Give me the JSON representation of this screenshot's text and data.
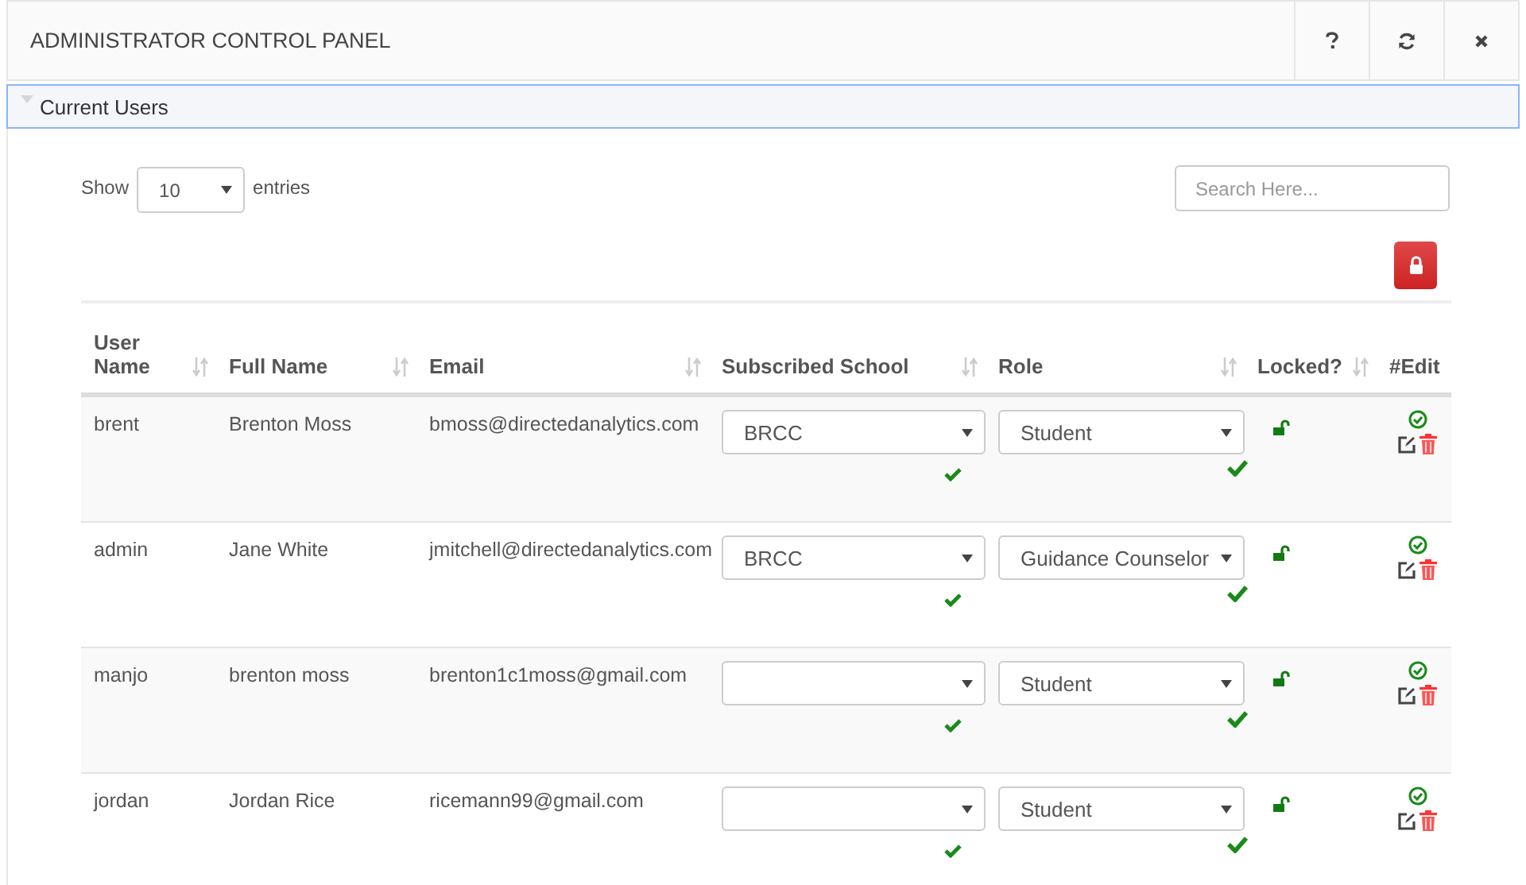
{
  "window": {
    "title": "ADMINISTRATOR CONTROL PANEL"
  },
  "section": {
    "title": "Current Users",
    "expanded": true
  },
  "length_menu": {
    "before": "Show",
    "value": "10",
    "after": "entries"
  },
  "search": {
    "placeholder": "Search Here..."
  },
  "table": {
    "columns": [
      {
        "label": "User Name",
        "sortable": true
      },
      {
        "label": "Full Name",
        "sortable": true
      },
      {
        "label": "Email",
        "sortable": true
      },
      {
        "label": "Subscribed School",
        "sortable": true
      },
      {
        "label": "Role",
        "sortable": true
      },
      {
        "label": "Locked?",
        "sortable": true
      },
      {
        "label": "#Edit",
        "sortable": false
      }
    ],
    "rows": [
      {
        "username": "brent",
        "full_name": "Brenton Moss",
        "email": "bmoss@directedanalytics.com",
        "school": "BRCC",
        "role": "Student",
        "locked": false
      },
      {
        "username": "admin",
        "full_name": "Jane White",
        "email": "jmitchell@directedanalytics.com",
        "school": "BRCC",
        "role": "Guidance Counselor",
        "locked": false
      },
      {
        "username": "manjo",
        "full_name": "brenton moss",
        "email": "brenton1c1moss@gmail.com",
        "school": "",
        "role": "Student",
        "locked": false
      },
      {
        "username": "jordan",
        "full_name": "Jordan Rice",
        "email": "ricemann99@gmail.com",
        "school": "",
        "role": "Student",
        "locked": false
      }
    ]
  }
}
